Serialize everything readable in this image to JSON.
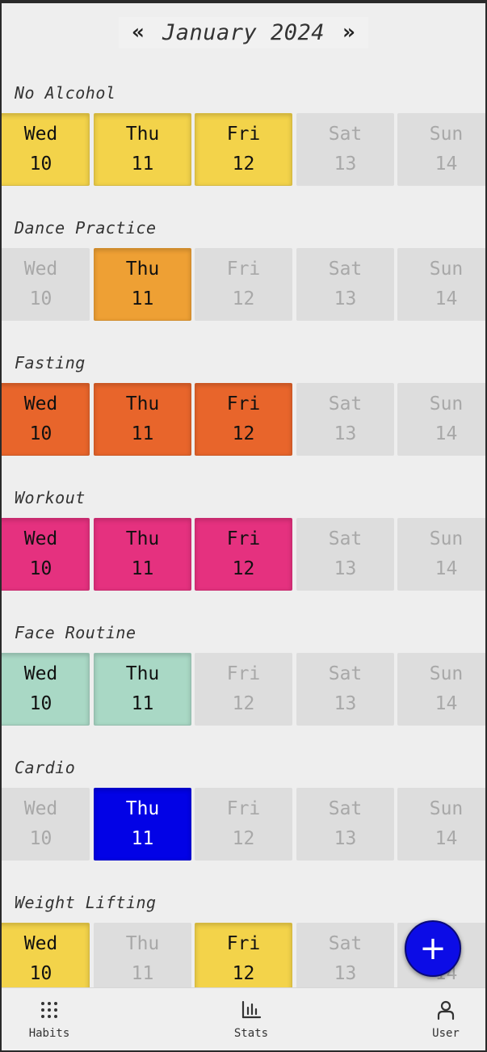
{
  "header": {
    "prev_label": "«",
    "month_title": "January 2024",
    "next_label": "»"
  },
  "habits": [
    {
      "name": "No Alcohol",
      "color": "#f3d34a",
      "text_color": "dark",
      "days": [
        {
          "dow": "Wed",
          "num": "10",
          "done": true
        },
        {
          "dow": "Thu",
          "num": "11",
          "done": true
        },
        {
          "dow": "Fri",
          "num": "12",
          "done": true
        },
        {
          "dow": "Sat",
          "num": "13",
          "done": false
        },
        {
          "dow": "Sun",
          "num": "14",
          "done": false
        }
      ]
    },
    {
      "name": "Dance Practice",
      "color": "#eea034",
      "text_color": "dark",
      "days": [
        {
          "dow": "Wed",
          "num": "10",
          "done": false
        },
        {
          "dow": "Thu",
          "num": "11",
          "done": true
        },
        {
          "dow": "Fri",
          "num": "12",
          "done": false
        },
        {
          "dow": "Sat",
          "num": "13",
          "done": false
        },
        {
          "dow": "Sun",
          "num": "14",
          "done": false
        }
      ]
    },
    {
      "name": "Fasting",
      "color": "#e8652b",
      "text_color": "dark",
      "days": [
        {
          "dow": "Wed",
          "num": "10",
          "done": true
        },
        {
          "dow": "Thu",
          "num": "11",
          "done": true
        },
        {
          "dow": "Fri",
          "num": "12",
          "done": true
        },
        {
          "dow": "Sat",
          "num": "13",
          "done": false
        },
        {
          "dow": "Sun",
          "num": "14",
          "done": false
        }
      ]
    },
    {
      "name": "Workout",
      "color": "#e5317f",
      "text_color": "dark",
      "days": [
        {
          "dow": "Wed",
          "num": "10",
          "done": true
        },
        {
          "dow": "Thu",
          "num": "11",
          "done": true
        },
        {
          "dow": "Fri",
          "num": "12",
          "done": true
        },
        {
          "dow": "Sat",
          "num": "13",
          "done": false
        },
        {
          "dow": "Sun",
          "num": "14",
          "done": false
        }
      ]
    },
    {
      "name": "Face Routine",
      "color": "#a9d8c5",
      "text_color": "dark",
      "days": [
        {
          "dow": "Wed",
          "num": "10",
          "done": true
        },
        {
          "dow": "Thu",
          "num": "11",
          "done": true
        },
        {
          "dow": "Fri",
          "num": "12",
          "done": false
        },
        {
          "dow": "Sat",
          "num": "13",
          "done": false
        },
        {
          "dow": "Sun",
          "num": "14",
          "done": false
        }
      ]
    },
    {
      "name": "Cardio",
      "color": "#0202e6",
      "text_color": "light",
      "days": [
        {
          "dow": "Wed",
          "num": "10",
          "done": false
        },
        {
          "dow": "Thu",
          "num": "11",
          "done": true
        },
        {
          "dow": "Fri",
          "num": "12",
          "done": false
        },
        {
          "dow": "Sat",
          "num": "13",
          "done": false
        },
        {
          "dow": "Sun",
          "num": "14",
          "done": false
        }
      ]
    },
    {
      "name": "Weight Lifting",
      "color": "#f3d34a",
      "text_color": "dark",
      "days": [
        {
          "dow": "Wed",
          "num": "10",
          "done": true
        },
        {
          "dow": "Thu",
          "num": "11",
          "done": false
        },
        {
          "dow": "Fri",
          "num": "12",
          "done": true
        },
        {
          "dow": "Sat",
          "num": "13",
          "done": false
        },
        {
          "dow": "Sun",
          "num": "14",
          "done": false
        }
      ]
    }
  ],
  "fab": {
    "icon": "plus-icon",
    "color": "#0c0ce6"
  },
  "bottom_nav": [
    {
      "label": "Habits",
      "icon": "grid-dots-icon"
    },
    {
      "label": "Stats",
      "icon": "bar-chart-icon"
    },
    {
      "label": "User",
      "icon": "user-icon"
    }
  ]
}
